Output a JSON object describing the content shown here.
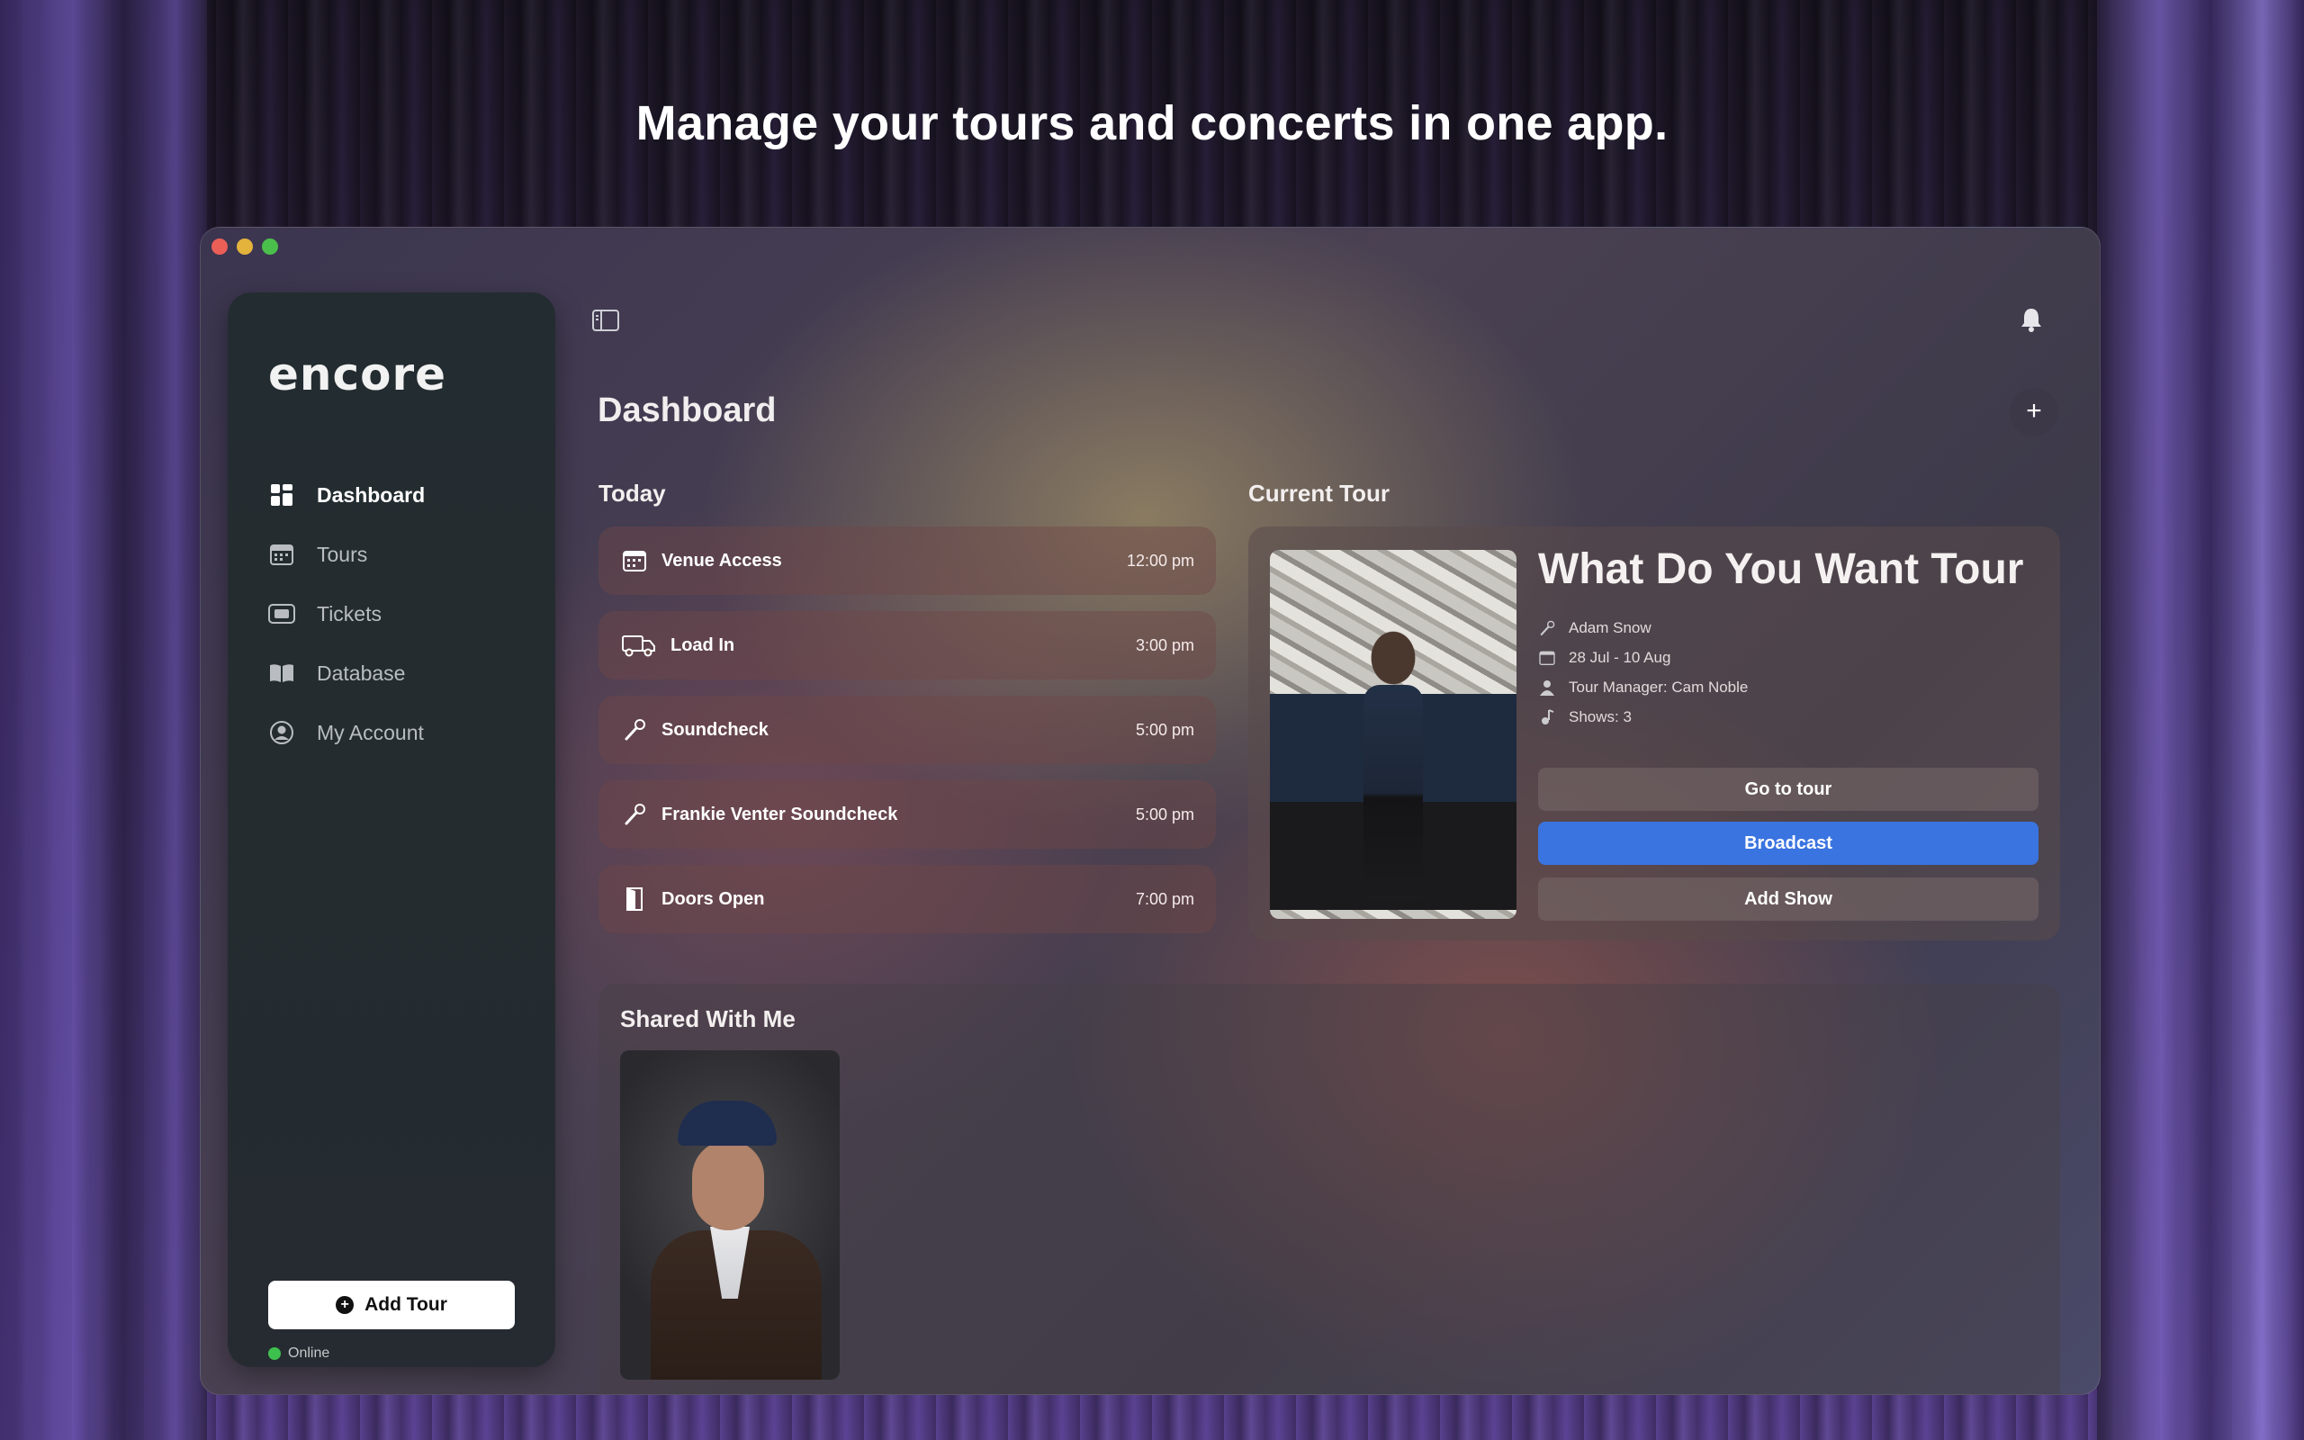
{
  "headline": "Manage your tours and concerts in one app.",
  "app": {
    "logo_text": "encore",
    "nav": [
      {
        "label": "Dashboard",
        "icon": "grid-icon",
        "active": true
      },
      {
        "label": "Tours",
        "icon": "calendar-icon",
        "active": false
      },
      {
        "label": "Tickets",
        "icon": "ticket-icon",
        "active": false
      },
      {
        "label": "Database",
        "icon": "book-icon",
        "active": false
      },
      {
        "label": "My Account",
        "icon": "user-circle-icon",
        "active": false
      }
    ],
    "add_tour_label": "Add Tour",
    "status_label": "Online",
    "status_color": "#3ec04f"
  },
  "main": {
    "page_title": "Dashboard",
    "today_title": "Today",
    "today_items": [
      {
        "label": "Venue Access",
        "time": "12:00 pm",
        "icon": "calendar-icon"
      },
      {
        "label": "Load In",
        "time": "3:00 pm",
        "icon": "truck-icon"
      },
      {
        "label": "Soundcheck",
        "time": "5:00 pm",
        "icon": "microphone-icon"
      },
      {
        "label": "Frankie Venter Soundcheck",
        "time": "5:00 pm",
        "icon": "microphone-icon"
      },
      {
        "label": "Doors Open",
        "time": "7:00 pm",
        "icon": "door-icon"
      }
    ],
    "current_tour_title": "Current Tour",
    "current_tour": {
      "name": "What Do You Want Tour",
      "artist": "Adam Snow",
      "dates": "28 Jul - 10 Aug",
      "manager": "Tour Manager: Cam Noble",
      "shows": "Shows: 3",
      "go_label": "Go to tour",
      "broadcast_label": "Broadcast",
      "add_show_label": "Add Show",
      "accent": "#3a74e0"
    },
    "shared_title": "Shared With Me"
  }
}
